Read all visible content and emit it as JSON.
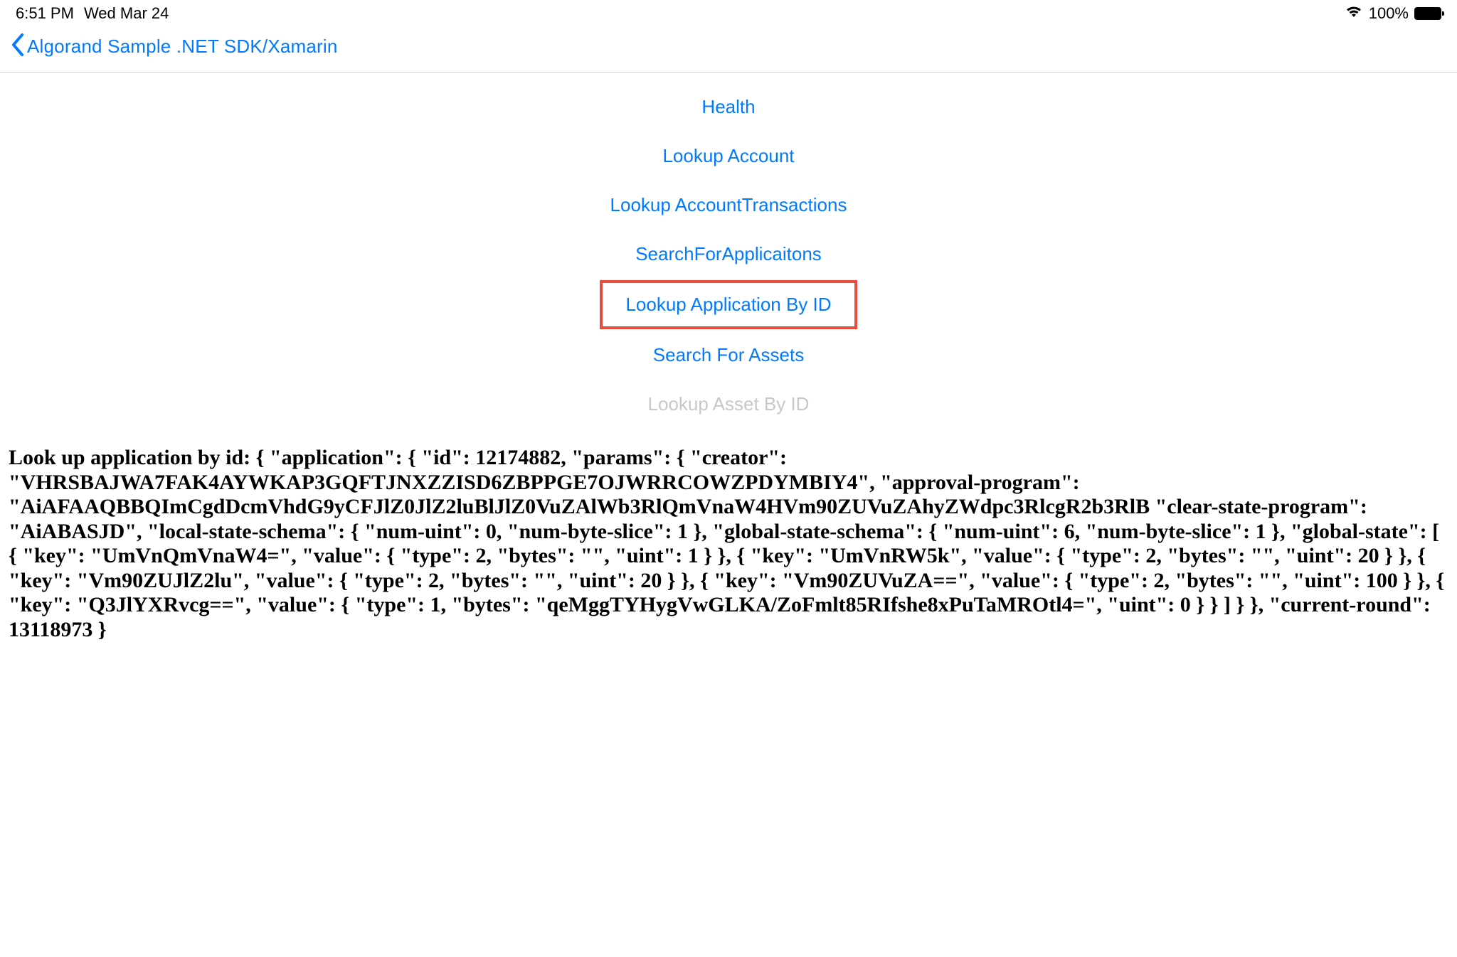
{
  "status_bar": {
    "time": "6:51 PM",
    "date": "Wed Mar 24",
    "battery_percent": "100%"
  },
  "nav": {
    "back_label": "Algorand Sample .NET SDK/Xamarin"
  },
  "actions": {
    "items": [
      {
        "label": "Health"
      },
      {
        "label": "Lookup Account"
      },
      {
        "label": "Lookup AccountTransactions"
      },
      {
        "label": "SearchForApplicaitons"
      },
      {
        "label": "Lookup Application By ID"
      },
      {
        "label": "Search For Assets"
      },
      {
        "label": "Lookup Asset By ID"
      }
    ]
  },
  "result": {
    "text": "Look up application by id: { \"application\": { \"id\": 12174882, \"params\": { \"creator\": \"VHRSBAJWA7FAK4AYWKAP3GQFTJNXZZISD6ZBPPGE7OJWRRCOWZPDYMBIY4\", \"approval-program\": \"AiAFAAQBBQImCgdDcmVhdG9yCFJlZ0JlZ2luBlJlZ0VuZAlWb3RlQmVnaW4HVm90ZUVuZAhyZWdpc3RlcgR2b3RlB \"clear-state-program\": \"AiABASJD\", \"local-state-schema\": { \"num-uint\": 0, \"num-byte-slice\": 1 }, \"global-state-schema\": { \"num-uint\": 6, \"num-byte-slice\": 1 }, \"global-state\": [ { \"key\": \"UmVnQmVnaW4=\", \"value\": { \"type\": 2, \"bytes\": \"\", \"uint\": 1 } }, { \"key\": \"UmVnRW5k\", \"value\": { \"type\": 2, \"bytes\": \"\", \"uint\": 20 } }, { \"key\": \"Vm90ZUJlZ2lu\", \"value\": { \"type\": 2, \"bytes\": \"\", \"uint\": 20 } }, { \"key\": \"Vm90ZUVuZA==\", \"value\": { \"type\": 2, \"bytes\": \"\", \"uint\": 100 } }, { \"key\": \"Q3JlYXRvcg==\", \"value\": { \"type\": 1, \"bytes\": \"qeMggTYHygVwGLKA/ZoFmlt85RIfshe8xPuTaMROtl4=\", \"uint\": 0 } } ] } }, \"current-round\": 13118973 }"
  }
}
